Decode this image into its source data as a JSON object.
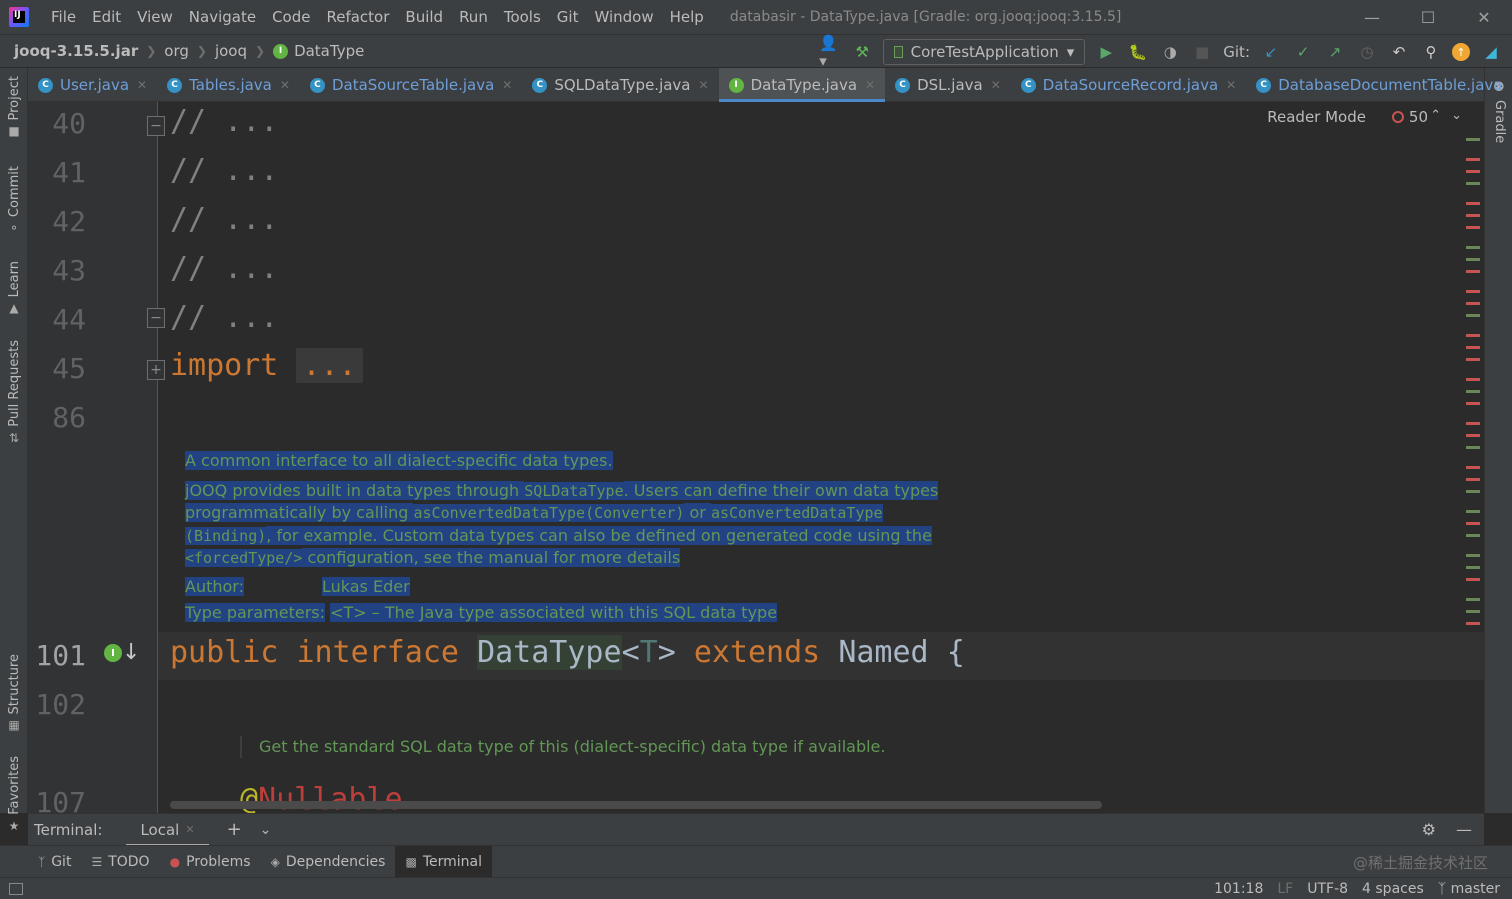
{
  "window": {
    "title": "databasir - DataType.java [Gradle: org.jooq:jooq:3.15.5]",
    "menu": [
      "File",
      "Edit",
      "View",
      "Navigate",
      "Code",
      "Refactor",
      "Build",
      "Run",
      "Tools",
      "Git",
      "Window",
      "Help"
    ]
  },
  "navbar": {
    "breadcrumbs": [
      "jooq-3.15.5.jar",
      "org",
      "jooq",
      "DataType"
    ],
    "run_config": "CoreTestApplication",
    "git_label": "Git:"
  },
  "tabs": [
    {
      "label": "User.java",
      "icon": "class-icon"
    },
    {
      "label": "Tables.java",
      "icon": "class-icon"
    },
    {
      "label": "DataSourceTable.java",
      "icon": "class-icon"
    },
    {
      "label": "SQLDataType.java",
      "icon": "class-icon"
    },
    {
      "label": "DataType.java",
      "icon": "interface-icon",
      "active": true
    },
    {
      "label": "DSL.java",
      "icon": "class-icon"
    },
    {
      "label": "DataSourceRecord.java",
      "icon": "class-icon"
    },
    {
      "label": "DatabaseDocumentTable.java",
      "icon": "class-icon"
    }
  ],
  "left_tools": [
    "Project",
    "Commit",
    "Learn",
    "Pull Requests",
    "Structure",
    "Favorites"
  ],
  "right_tools": [
    "Gradle"
  ],
  "editor": {
    "reader_mode": "Reader Mode",
    "problem_count": "50",
    "lines": [
      {
        "num": "40",
        "code": "// ..."
      },
      {
        "num": "41",
        "code": "// ..."
      },
      {
        "num": "42",
        "code": "// ..."
      },
      {
        "num": "43",
        "code": "// ..."
      },
      {
        "num": "44",
        "code": "// ..."
      },
      {
        "num": "45",
        "kw": "import",
        "folded": "..."
      },
      {
        "num": "86",
        "code": ""
      },
      {
        "num": "101",
        "current": true
      },
      {
        "num": "102",
        "code": ""
      },
      {
        "num": "107",
        "ann": "@",
        "ann_name": "Nullable"
      }
    ],
    "line101": {
      "kw1": "public",
      "kw2": "interface",
      "name": "DataType",
      "lt": "<",
      "type_param": "T",
      "gt": ">",
      "kw3": "extends",
      "parent": "Named",
      "brace": "{"
    },
    "javadoc": {
      "summary": "A common interface to all dialect-specific data types.",
      "p1": "jOOQ provides built in data types through ",
      "p1_code": "SQLDataType",
      "p1b": ". Users can define their own data types",
      "p2": "programmatically by calling ",
      "p2_code1": "asConvertedDataType(Converter)",
      "p2_or": " or ",
      "p2_code2": "asConvertedDataType",
      "p3_code": "(Binding)",
      "p3": ", for example. Custom data types can also be defined on generated code using the",
      "p4_code": "<forcedType/>",
      "p4": " configuration, see the manual for more details",
      "author_label": "Author:",
      "author_value": "Lukas Eder",
      "type_params_label": "Type parameters:",
      "type_params_value": "<T> – The Java type associated with this SQL data type"
    },
    "javadoc2": "Get the standard SQL data type of this (dialect-specific) data type if available."
  },
  "terminal": {
    "title": "Terminal:",
    "tab": "Local"
  },
  "bottom_tools": [
    "Git",
    "TODO",
    "Problems",
    "Dependencies",
    "Terminal"
  ],
  "watermark": "@稀土掘金技术社区",
  "status": {
    "position": "101:18",
    "line_sep": "LF",
    "encoding": "UTF-8",
    "indent": "4 spaces",
    "branch": "master"
  },
  "colors": {
    "background": "#2b2b2b",
    "keyword": "#cc7832",
    "doc_text": "#629755",
    "selection": "#214283",
    "accent": "#4a88c7"
  }
}
